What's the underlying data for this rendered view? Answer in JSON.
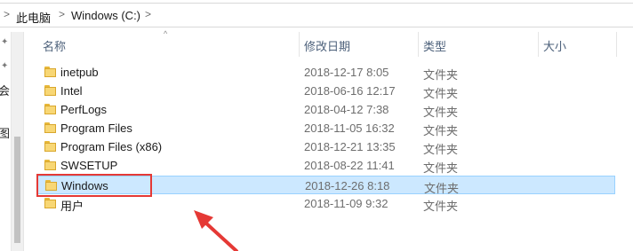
{
  "address": {
    "crumbs": [
      "此电脑",
      "Windows (C:)"
    ],
    "separator": ">"
  },
  "nav": {
    "partial_labels": [
      "会",
      "图"
    ],
    "pin_glyph": "✦"
  },
  "columns": {
    "name": "名称",
    "date": "修改日期",
    "type": "类型",
    "size": "大小",
    "sort_indicator": "^"
  },
  "files": [
    {
      "name": "inetpub",
      "date": "2018-12-17 8:05",
      "type": "文件夹"
    },
    {
      "name": "Intel",
      "date": "2018-06-16 12:17",
      "type": "文件夹"
    },
    {
      "name": "PerfLogs",
      "date": "2018-04-12 7:38",
      "type": "文件夹"
    },
    {
      "name": "Program Files",
      "date": "2018-11-05 16:32",
      "type": "文件夹"
    },
    {
      "name": "Program Files (x86)",
      "date": "2018-12-21 13:35",
      "type": "文件夹"
    },
    {
      "name": "SWSETUP",
      "date": "2018-08-22 11:41",
      "type": "文件夹"
    },
    {
      "name": "Windows",
      "date": "2018-12-26 8:18",
      "type": "文件夹",
      "selected": true
    },
    {
      "name": "用户",
      "date": "2018-11-09 9:32",
      "type": "文件夹"
    }
  ],
  "colors": {
    "selection": "#cce8ff",
    "selection_border": "#99d1ff",
    "annotation": "#e53935",
    "folder": "#f8d775"
  }
}
